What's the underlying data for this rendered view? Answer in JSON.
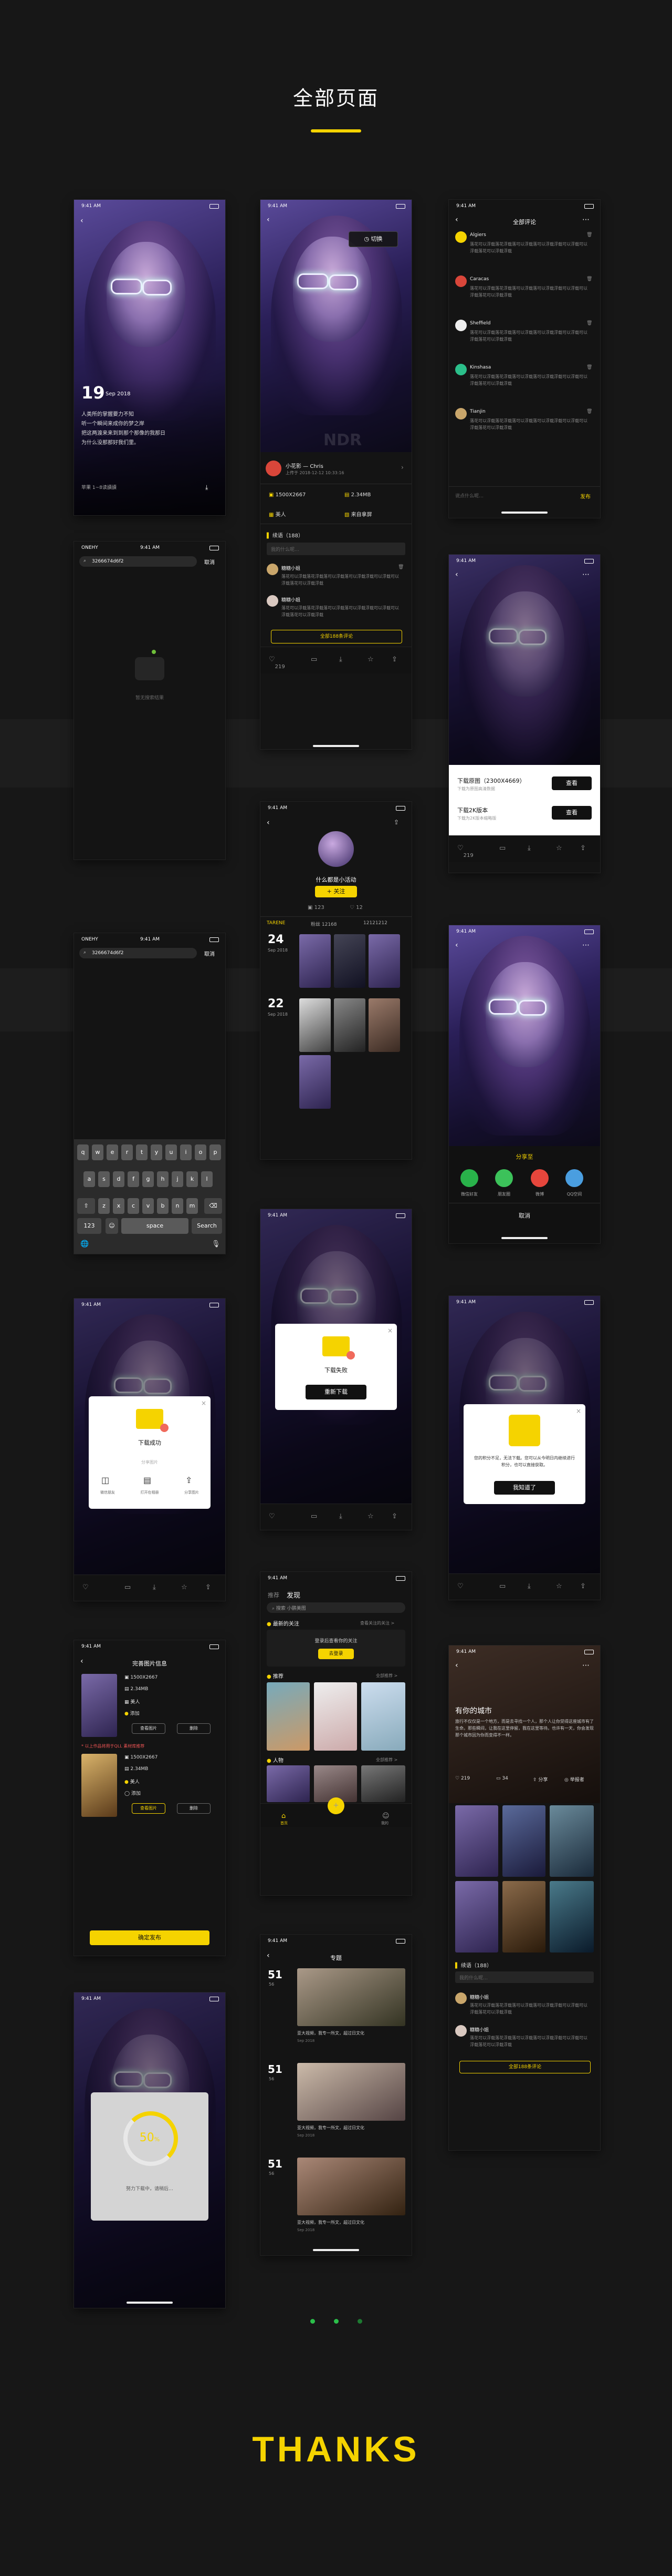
{
  "page": {
    "title": "全部页面",
    "thanks": "THANKS"
  },
  "colors": {
    "accent": "#f5d300",
    "background": "#171717",
    "card": "#141414"
  },
  "status_time": "9:41 AM",
  "status_carrier": "ONEHY",
  "status_battery": "100%",
  "screen1": {
    "day": "19",
    "month": "Sep 2018",
    "quote": [
      "人类所的掌握要力不知",
      "听一个瞬间来成你的梦之岸",
      "把这两渡来来到到那个那像的我那日",
      "为什么没那那好我们里。"
    ],
    "author": "苹果 1~8读讀讀"
  },
  "screen2": {
    "toast": "切换",
    "author": "小花影 — Chris",
    "date": "上传于 2018-12-12 10:33:16",
    "size_px": "1500X2667",
    "size_mb": "2.34MB",
    "category": "美人",
    "source": "来自拿屏",
    "comments_title": "续语（188）",
    "comment_placeholder": "我的什么呢…",
    "comments": [
      {
        "name": "糖糖小姐",
        "text": "落花可以浮载落花浮载落可以浮载落可以浮载浮载可以浮载可以浮载落花可以浮载浮载"
      },
      {
        "name": "糖糖小姐",
        "text": "落花可以浮载落花浮载落可以浮载落可以浮载浮载可以浮载可以浮载落花可以浮载浮载"
      }
    ],
    "all_comments": "全部188条评论",
    "likes": "219"
  },
  "screen3": {
    "title": "全部评论",
    "comments": [
      {
        "name": "Algiers",
        "text": "落花可以浮载落花浮载落可以浮载落可以浮载浮载可以浮载可以浮载落花可以浮载浮载"
      },
      {
        "name": "Caracas",
        "text": "落花可以浮载落花浮载落可以浮载落可以浮载浮载可以浮载可以浮载落花可以浮载浮载"
      },
      {
        "name": "Sheffield",
        "text": "落花可以浮载落花浮载落可以浮载落可以浮载浮载可以浮载可以浮载落花可以浮载浮载"
      },
      {
        "name": "Kinshasa",
        "text": "落花可以浮载落花浮载落可以浮载落可以浮载浮载可以浮载可以浮载落花可以浮载浮载"
      },
      {
        "name": "Tianjin",
        "text": "落花可以浮载落花浮载落可以浮载落可以浮载浮载可以浮载可以浮载落花可以浮载浮载"
      }
    ],
    "placeholder": "说点什么呢…",
    "send": "发布"
  },
  "screen4": {
    "search_value": "3266674d6f2",
    "cancel": "取消",
    "empty": "暂无搜索结果"
  },
  "screen5": {
    "options": [
      {
        "title": "下载原图（2300X4669）",
        "desc": "下载为原图高清数据",
        "btn": "查看"
      },
      {
        "title": "下载2K版本",
        "desc": "下载为2K版本缩略版",
        "btn": "查看"
      }
    ],
    "likes": "219"
  },
  "screen6": {
    "name": "什么都是小活动",
    "follow": "+ 关注",
    "stat1": "123",
    "stat2": "12",
    "tabs": [
      "TARENE",
      "粉丝 12168",
      "12121212"
    ],
    "dates": [
      {
        "day": "24",
        "month": "Sep 2018"
      },
      {
        "day": "22",
        "month": "Sep 2018"
      }
    ]
  },
  "screen7": {
    "search_value": "3266674d6f2",
    "cancel": "取消",
    "rows": [
      [
        "q",
        "w",
        "e",
        "r",
        "t",
        "y",
        "u",
        "i",
        "o",
        "p"
      ],
      [
        "a",
        "s",
        "d",
        "f",
        "g",
        "h",
        "j",
        "k",
        "l"
      ],
      [
        "z",
        "x",
        "c",
        "v",
        "b",
        "n",
        "m"
      ]
    ],
    "key123": "123",
    "space": "space",
    "search": "Search"
  },
  "screen8": {
    "title": "分享至",
    "items": [
      "微信好友",
      "朋友圈",
      "微博",
      "QQ空间"
    ],
    "cancel": "取消"
  },
  "screen9": {
    "title": "下载成功",
    "sub": "分享图片",
    "items": [
      "微信朋友",
      "打开在相册",
      "分享图片"
    ]
  },
  "screen10": {
    "title": "下载失败",
    "btn": "重新下载"
  },
  "screen11": {
    "text": "您的积分不足，无法下载。您可以从今明日内继续进行积分，也可以直接获取。",
    "btn": "我知道了"
  },
  "screen12": {
    "tabs": [
      "推荐",
      "发现"
    ],
    "search": "搜索 小鹏美图",
    "section1": "最新的关注",
    "more1": "查看关注的关注 >",
    "login_text": "登录后查看你的关注",
    "login_btn": "去登录",
    "section2": "推荐",
    "more2": "全部推荐 >",
    "section3": "人物",
    "more3": "全部推荐 >",
    "nav": [
      "首页",
      "",
      "我的"
    ]
  },
  "screen13": {
    "title": "完善图片信息",
    "items": [
      {
        "size_px": "1500X2667",
        "size_mb": "2.34MB",
        "category": "美人",
        "tag": "添加"
      },
      {
        "size_px": "1500X2667",
        "size_mb": "2.34MB",
        "category": "美人",
        "tag": "添加"
      }
    ],
    "warn": "* 以上作品将用于QLL 素材库推荐",
    "btn_a": "查看图片",
    "btn_b": "删除",
    "submit": "确定发布"
  },
  "screen14": {
    "title": "有你的城市",
    "desc": "旅行不仅仅是一个地方，而是去寻找一个人，那个人让你觉得这座城市有了生命。那些瞬间，让我在这里停留，我在这里等待。也许有一天，你会发现那个城市因为你而变得不一样。",
    "likes": "219",
    "comments": "34",
    "share": "分享",
    "report": "举报者",
    "comments_title": "续语（188）",
    "placeholder": "我的什么呢…",
    "comment_list": [
      {
        "name": "糖糖小姐",
        "text": "落花可以浮载落花浮载落可以浮载落可以浮载浮载可以浮载可以浮载落花可以浮载浮载"
      },
      {
        "name": "糖糖小姐",
        "text": "落花可以浮载落花浮载落可以浮载落可以浮载浮载可以浮载可以浮载落花可以浮载浮载"
      }
    ],
    "all": "全部188条评论"
  },
  "screen15": {
    "title": "专题",
    "items": [
      {
        "day": "51",
        "unit": "56",
        "caption": "亚大视频，我专一所文，超过日文化",
        "meta": "Sep 2018"
      },
      {
        "day": "51",
        "unit": "56",
        "caption": "亚大视频，我专一所文，超过日文化",
        "meta": "Sep 2018"
      },
      {
        "day": "51",
        "unit": "56",
        "caption": "亚大视频，我专一所文，超过日文化",
        "meta": "Sep 2018"
      }
    ]
  },
  "screen16": {
    "percent": "50",
    "unit": "%",
    "text": "努力下载中，请稍后…"
  }
}
